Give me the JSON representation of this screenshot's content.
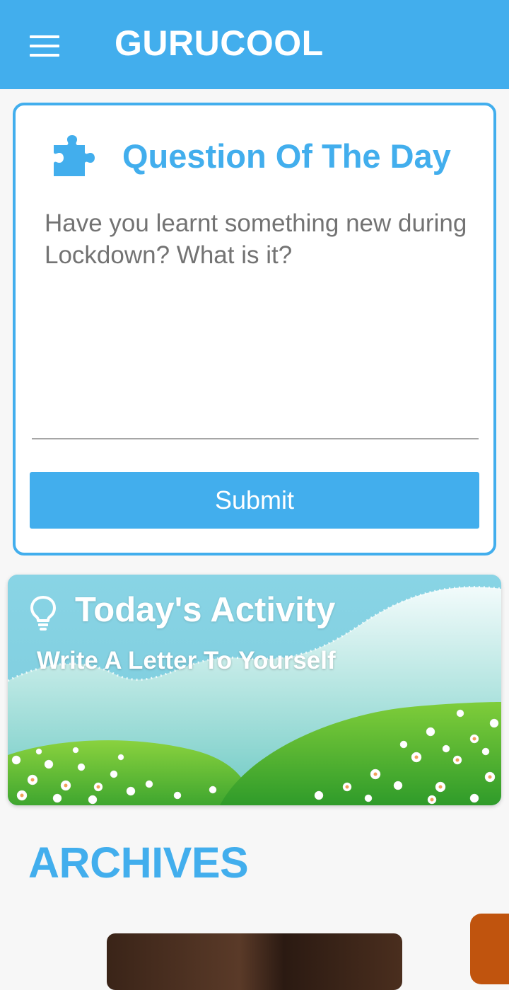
{
  "app": {
    "title": "GURUCOOL"
  },
  "question_of_the_day": {
    "title": "Question Of The Day",
    "question": "Have you learnt something new during Lockdown? What is it?",
    "answer_value": "",
    "submit_label": "Submit"
  },
  "activity": {
    "title": "Today's Activity",
    "subtitle": "Write A Letter To Yourself"
  },
  "archives": {
    "heading": "ARCHIVES"
  },
  "icons": {
    "menu": "hamburger-menu-icon",
    "question": "puzzle-piece-icon",
    "activity": "lightbulb-icon"
  },
  "colors": {
    "primary": "#42aeed",
    "background": "#f7f7f7",
    "card": "#ffffff",
    "text_muted": "#737373"
  }
}
